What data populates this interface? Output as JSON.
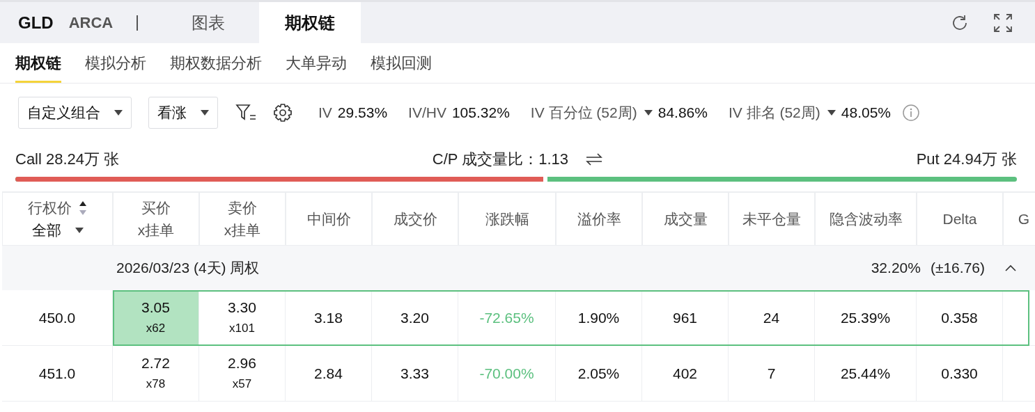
{
  "header": {
    "symbol": "GLD",
    "exchange": "ARCA",
    "tabs": [
      {
        "label": "图表",
        "selected": false
      },
      {
        "label": "期权链",
        "selected": true
      }
    ]
  },
  "subtabs": [
    {
      "label": "期权链",
      "selected": true
    },
    {
      "label": "模拟分析",
      "selected": false
    },
    {
      "label": "期权数据分析",
      "selected": false
    },
    {
      "label": "大单异动",
      "selected": false
    },
    {
      "label": "模拟回测",
      "selected": false
    }
  ],
  "toolbar": {
    "strategy": "自定义组合",
    "direction": "看涨",
    "stats": [
      {
        "label": "IV",
        "value": "29.53%",
        "dropdown": false
      },
      {
        "label": "IV/HV",
        "value": "105.32%",
        "dropdown": false
      },
      {
        "label": "IV 百分位 (52周)",
        "value": "84.86%",
        "dropdown": true
      },
      {
        "label": "IV 排名 (52周)",
        "value": "48.05%",
        "dropdown": true
      }
    ]
  },
  "volume": {
    "call": "Call 28.24万 张",
    "ratio_label": "C/P 成交量比：",
    "ratio": "1.13",
    "put": "Put 24.94万 张",
    "level": 0.531
  },
  "table": {
    "strike_header": "行权价",
    "strike_filter": "全部",
    "columns": [
      [
        "买价",
        "x挂单"
      ],
      [
        "卖价",
        "x挂单"
      ],
      [
        "中间价"
      ],
      [
        "成交价"
      ],
      [
        "涨跌幅"
      ],
      [
        "溢价率"
      ],
      [
        "成交量"
      ],
      [
        "未平仓量"
      ],
      [
        "隐含波动率"
      ],
      [
        "Delta"
      ],
      [
        "G"
      ]
    ],
    "group": {
      "label": "2026/03/23 (4天) 周权",
      "iv": "32.20%",
      "move": "(±16.76)",
      "expanded": true
    },
    "rows": [
      {
        "strike": "450.0",
        "selected": true,
        "bid": "3.05",
        "bid_size": "x62",
        "bid_highlighted": true,
        "ask": "3.30",
        "ask_size": "x101",
        "mid": "3.18",
        "last": "3.20",
        "change": "-72.65%",
        "premium": "1.90%",
        "volume": "961",
        "open_interest": "24",
        "iv": "25.39%",
        "delta": "0.358"
      },
      {
        "strike": "451.0",
        "selected": false,
        "bid": "2.72",
        "bid_size": "x78",
        "bid_highlighted": false,
        "ask": "2.96",
        "ask_size": "x57",
        "mid": "2.84",
        "last": "3.33",
        "change": "-70.00%",
        "premium": "2.05%",
        "volume": "402",
        "open_interest": "7",
        "iv": "25.44%",
        "delta": "0.330"
      }
    ]
  }
}
